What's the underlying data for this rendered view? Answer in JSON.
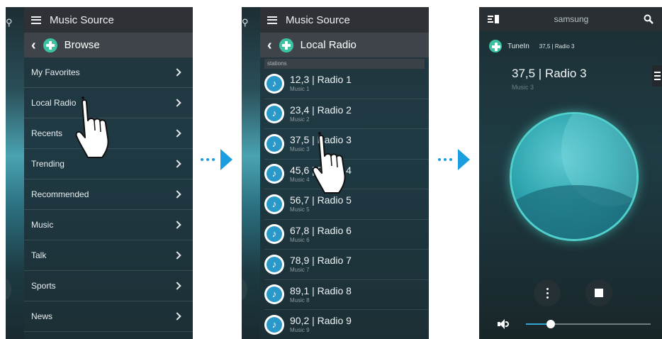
{
  "screen1": {
    "header_title": "Music Source",
    "subheader_title": "Browse",
    "menu": [
      {
        "label": "My Favorites"
      },
      {
        "label": "Local Radio"
      },
      {
        "label": "Recents"
      },
      {
        "label": "Trending"
      },
      {
        "label": "Recommended"
      },
      {
        "label": "Music"
      },
      {
        "label": "Talk"
      },
      {
        "label": "Sports"
      },
      {
        "label": "News"
      }
    ]
  },
  "screen2": {
    "header_title": "Music Source",
    "subheader_title": "Local Radio",
    "section_label": "stations",
    "stations": [
      {
        "title": "12,3 | Radio 1",
        "subtitle": "Music 1"
      },
      {
        "title": "23,4 | Radio 2",
        "subtitle": "Music 2"
      },
      {
        "title": "37,5 | Radio 3",
        "subtitle": "Music 3"
      },
      {
        "title": "45,6 | Radio 4",
        "subtitle": "Music 4"
      },
      {
        "title": "56,7 | Radio 5",
        "subtitle": "Music 5"
      },
      {
        "title": "67,8 | Radio 6",
        "subtitle": "Music 6"
      },
      {
        "title": "78,9 | Radio 7",
        "subtitle": "Music 7"
      },
      {
        "title": "89,1 | Radio 8",
        "subtitle": "Music 8"
      },
      {
        "title": "90,2 | Radio 9",
        "subtitle": "Music 9"
      }
    ]
  },
  "screen3": {
    "device_name": "samsung",
    "source_name": "TuneIn",
    "source_station": "37,5 | Radio 3",
    "now_playing_title": "37,5 | Radio 3",
    "now_playing_subtitle": "Music 3",
    "volume_fraction": 0.2
  },
  "colors": {
    "accent_blue": "#1a9ee0",
    "tunein_green": "#3cc1a3",
    "album_teal": "#4fd0cc"
  },
  "icons": [
    "hamburger-icon",
    "back-chevron-icon",
    "tunein-icon",
    "chevron-right-icon",
    "music-note-icon",
    "speaker-list-icon",
    "search-icon",
    "more-vert-icon",
    "stop-icon",
    "volume-icon",
    "tap-hand-icon",
    "next-arrow-icon"
  ]
}
